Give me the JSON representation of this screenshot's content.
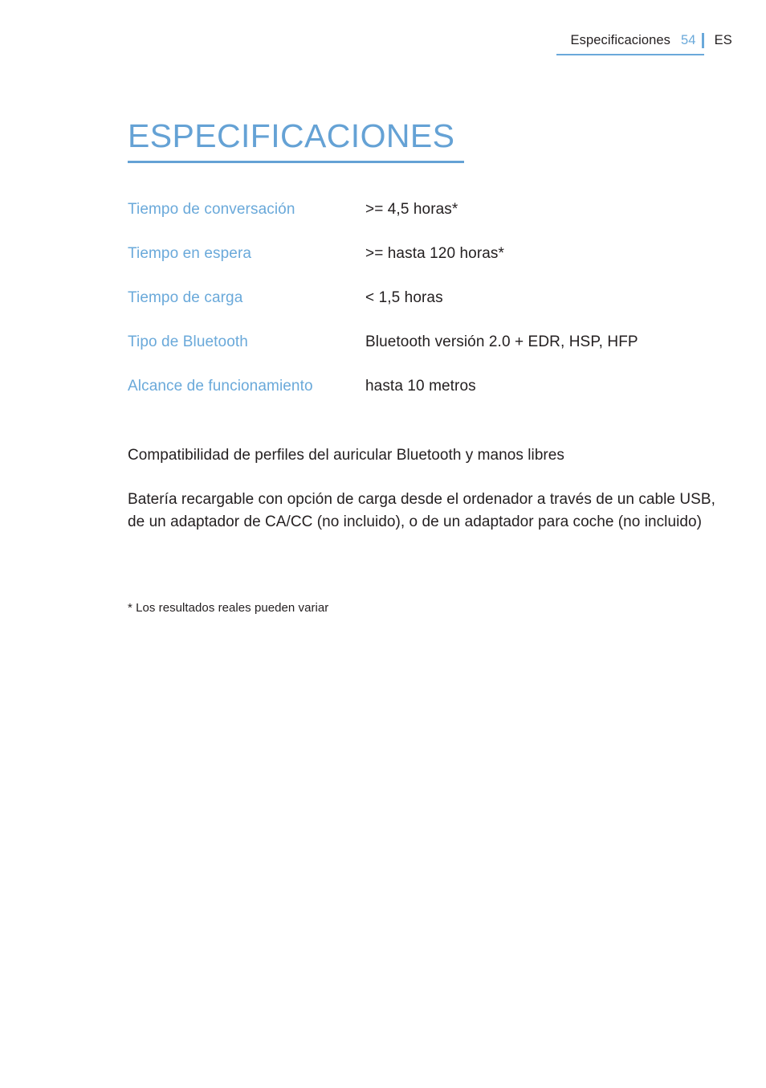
{
  "header": {
    "section": "Especificaciones",
    "page_number": "54",
    "language": "ES"
  },
  "title": "ESPECIFICACIONES",
  "spec_table": {
    "rows": [
      {
        "label": "Tiempo de conversación",
        "value": ">= 4,5 horas*"
      },
      {
        "label": "Tiempo en espera",
        "value": ">= hasta 120 horas*"
      },
      {
        "label": "Tiempo de carga",
        "value": "< 1,5 horas"
      },
      {
        "label": "Tipo de Bluetooth",
        "value": "Bluetooth versión 2.0 + EDR, HSP, HFP"
      },
      {
        "label": "Alcance de funcionamiento",
        "value": "hasta 10 metros"
      }
    ]
  },
  "body": {
    "paragraphs": [
      "Compatibilidad de perfiles del auricular Bluetooth y manos libres",
      "Batería recargable con opción de carga desde el ordenador a través de un cable USB, de un adaptador de CA/CC (no incluido), o de un adaptador para coche (no incluido)"
    ]
  },
  "footnote": "* Los resultados reales pueden variar",
  "colors": {
    "accent_blue": "#6aa9da",
    "title_blue": "#65a2d5",
    "text_dark": "#231f20",
    "background": "#ffffff"
  }
}
